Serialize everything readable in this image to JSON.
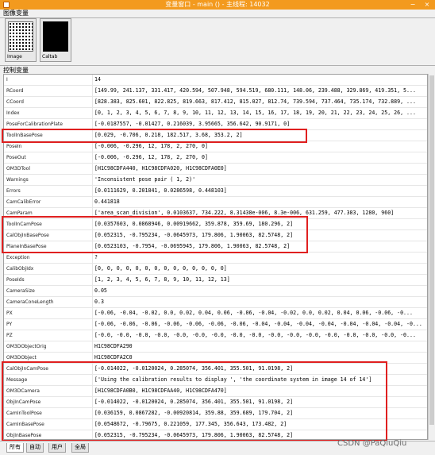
{
  "window": {
    "title": "变量窗口 - main () - 主线程: 14032",
    "minimize_glyph": "−",
    "close_glyph": "×"
  },
  "image_section": {
    "label": "图像变量",
    "thumbnails": [
      {
        "caption": "Image"
      },
      {
        "caption": "Caltab"
      }
    ]
  },
  "control_section": {
    "label": "控制变量",
    "rows": [
      {
        "name": "I",
        "value": "14"
      },
      {
        "name": "RCoord",
        "value": "[149.99, 241.137, 331.417, 420.594, 507.948, 594.519, 680.111, 148.06, 239.488, 329.869, 419.351, 5..."
      },
      {
        "name": "CCoord",
        "value": "[828.383, 825.601, 822.825, 819.663, 817.412, 815.027, 812.74, 739.594, 737.464, 735.174, 732.889, ..."
      },
      {
        "name": "Index",
        "value": "[0, 1, 2, 3, 4, 5, 6, 7, 8, 9, 10, 11, 12, 13, 14, 15, 16, 17, 18, 19, 20, 21, 22, 23, 24, 25, 26, ..."
      },
      {
        "name": "PoseForCalibrationPlate",
        "value": "[-0.0187557, -0.01427, 0.216039, 3.95665, 356.642, 90.9171, 0]"
      },
      {
        "name": "ToolInBasePose",
        "value": "[0.029, -0.706, 0.218, 182.517, 3.68, 353.2, 2]"
      },
      {
        "name": "PoseIn",
        "value": "[-0.006, -0.296, 12, 178, 2, 270, 0]"
      },
      {
        "name": "PoseOut",
        "value": "[-0.006, -0.296, 12, 178, 2, 270, 0]"
      },
      {
        "name": "OM3DTool",
        "value": "[H1C98CDFA440, H1C98CDFA020, H1C98CDFA0E0]"
      },
      {
        "name": "Warnings",
        "value": "'Inconsistent pose pair ( 1, 2)'"
      },
      {
        "name": "Errors",
        "value": "[0.0111629, 0.201841, 0.0286598, 0.448103]"
      },
      {
        "name": "CamCalibError",
        "value": "0.441818"
      },
      {
        "name": "CamParam",
        "value": "['area_scan_division', 0.0103637, 734.222, 8.31438e-006, 8.3e-006, 631.259, 477.383, 1280, 960]"
      },
      {
        "name": "ToolInCamPose",
        "value": "[0.0357603, 0.0868946, 0.00919662, 359.878, 359.69, 180.296, 2]"
      },
      {
        "name": "CalObjInBasePose",
        "value": "[0.052315, -0.795234, -0.0645973, 179.806, 1.90063, 82.5748, 2]"
      },
      {
        "name": "PlaneInBasePose",
        "value": "[0.0523103, -0.7954, -0.0695945, 179.806, 1.90063, 82.5748, 2]"
      },
      {
        "name": "Exception",
        "value": "?"
      },
      {
        "name": "CalibObjIdx",
        "value": "[0, 0, 0, 0, 0, 0, 0, 0, 0, 0, 0, 0, 0, 0]"
      },
      {
        "name": "PoseIds",
        "value": "[1, 2, 3, 4, 5, 6, 7, 8, 9, 10, 11, 12, 13]"
      },
      {
        "name": "CameraSize",
        "value": "0.05"
      },
      {
        "name": "CameraConeLength",
        "value": "0.3"
      },
      {
        "name": "PX",
        "value": "[-0.06, -0.04, -0.02, 0.0, 0.02, 0.04, 0.06, -0.06, -0.04, -0.02, 0.0, 0.02, 0.04, 0.06, -0.06, -0..."
      },
      {
        "name": "PY",
        "value": "[-0.06, -0.06, -0.06, -0.06, -0.06, -0.06, -0.06, -0.04, -0.04, -0.04, -0.04, -0.04, -0.04, -0.04, -0..."
      },
      {
        "name": "PZ",
        "value": "[-0.0, -0.0, -0.0, -0.0, -0.0, -0.0, -0.0, -0.0, -0.0, -0.0, -0.0, -0.0, -0.0, -0.0, -0.0, -0.0, -0..."
      },
      {
        "name": "OM3DObjectOrig",
        "value": "H1C98CDFA290"
      },
      {
        "name": "OM3DObject",
        "value": "H1C98CDFA2C0"
      },
      {
        "name": "CalObjInCamPose",
        "value": "[-0.014022, -0.0120024, 0.285074, 356.401, 355.501, 91.0198, 2]"
      },
      {
        "name": "Message",
        "value": "['Using the calibration results to display ', 'the coordinate system in image 14 of 14']"
      },
      {
        "name": "OM3DCamera",
        "value": "[H1C98CDFA0B0, H1C98CDFAA40, H1C98CDFA470]"
      },
      {
        "name": "ObjInCamPose",
        "value": "[-0.014022, -0.0120024, 0.285074, 356.401, 355.501, 91.0198, 2]"
      },
      {
        "name": "CamInToolPose",
        "value": "[0.036159, 0.0867282, -0.00920814, 359.88, 359.689, 179.704, 2]"
      },
      {
        "name": "CamInBasePose",
        "value": "[0.0548672, -0.79675, 0.221059, 177.345, 356.643, 173.482, 2]"
      },
      {
        "name": "ObjInBasePose",
        "value": "[0.052315, -0.795234, -0.0645973, 179.806, 1.90063, 82.5748, 2]"
      }
    ]
  },
  "tabs": [
    {
      "label": "所有",
      "active": true
    },
    {
      "label": "自动",
      "active": false
    },
    {
      "label": "用户",
      "active": false
    },
    {
      "label": "全局",
      "active": false
    }
  ],
  "watermark": "CSDN @PaQiuQiu",
  "colors": {
    "titlebar": "#f39a1e",
    "highlight": "#e02020"
  }
}
